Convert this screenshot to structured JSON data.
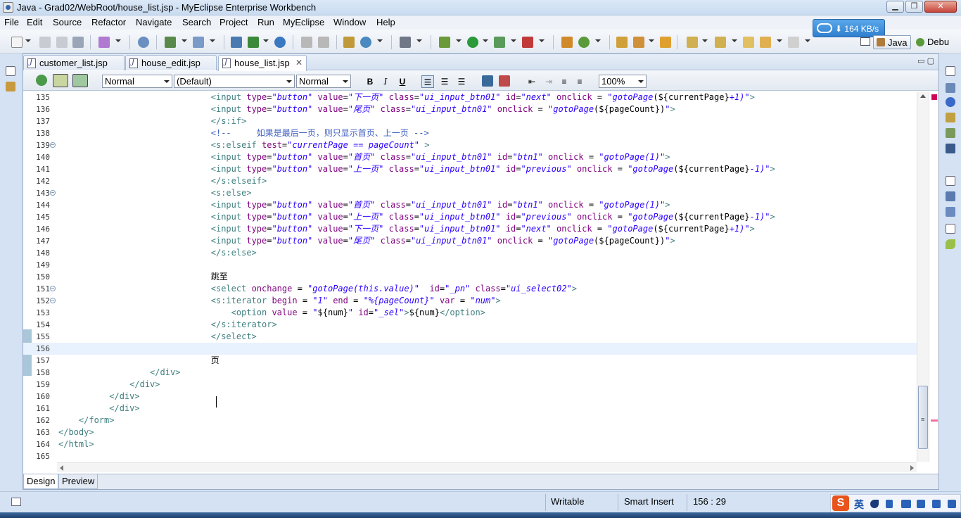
{
  "window": {
    "title": "Java - Grad02/WebRoot/house_list.jsp - MyEclipse Enterprise Workbench"
  },
  "menu": [
    "File",
    "Edit",
    "Source",
    "Refactor",
    "Navigate",
    "Search",
    "Project",
    "Run",
    "MyEclipse",
    "Window",
    "Help"
  ],
  "network_speed": "164 KB/s",
  "perspectives": {
    "java": "Java",
    "debug": "Debu"
  },
  "tabs": [
    {
      "label": "customer_list.jsp",
      "active": false
    },
    {
      "label": "house_edit.jsp",
      "active": false
    },
    {
      "label": "house_list.jsp",
      "active": true
    }
  ],
  "format_toolbar": {
    "paragraph_style": "Normal",
    "font": "(Default)",
    "size": "Normal",
    "zoom": "100%",
    "bold": "B",
    "italic": "I",
    "underline": "U"
  },
  "code_lines": [
    {
      "n": "135",
      "fold": "",
      "html": "                              <span class=\"t-tag\">&lt;input</span> <span class=\"t-attr\">type</span>=<span class=\"t-val\">\"button\"</span> <span class=\"t-attr\">value</span>=<span class=\"t-val\">\"下一页\"</span> <span class=\"t-attr\">class</span>=<span class=\"t-val\">\"ui_input_btn01\"</span> <span class=\"t-attr\">id</span>=<span class=\"t-val\">\"next\"</span> <span class=\"t-attr\">onclick</span> = <span class=\"t-val\">\"gotoPage</span>(${currentPage}<span class=\"t-val\">+1)\"</span><span class=\"t-tag\">&gt;</span>"
    },
    {
      "n": "136",
      "fold": "",
      "html": "                              <span class=\"t-tag\">&lt;input</span> <span class=\"t-attr\">type</span>=<span class=\"t-val\">\"button\"</span> <span class=\"t-attr\">value</span>=<span class=\"t-val\">\"尾页\"</span> <span class=\"t-attr\">class</span>=<span class=\"t-val\">\"ui_input_btn01\"</span> <span class=\"t-attr\">onclick</span> = <span class=\"t-val\">\"gotoPage</span>(${pageCount})<span class=\"t-val\">\"</span><span class=\"t-tag\">&gt;</span>"
    },
    {
      "n": "137",
      "fold": "",
      "html": "                              <span class=\"t-tag\">&lt;/s:if&gt;</span>"
    },
    {
      "n": "138",
      "fold": "",
      "html": "                              <span class=\"t-cmt\">&lt;!--     如果是最后一页，则只显示首页、上一页 --&gt;</span>"
    },
    {
      "n": "139",
      "fold": "⊖",
      "html": "                              <span class=\"t-tag\">&lt;s:elseif</span> <span class=\"t-attr\">test</span>=<span class=\"t-val\">\"currentPage == pageCount\"</span> <span class=\"t-tag\">&gt;</span>"
    },
    {
      "n": "140",
      "fold": "",
      "html": "                              <span class=\"t-tag\">&lt;input</span> <span class=\"t-attr\">type</span>=<span class=\"t-val\">\"button\"</span> <span class=\"t-attr\">value</span>=<span class=\"t-val\">\"首页\"</span> <span class=\"t-attr\">class</span>=<span class=\"t-val\">\"ui_input_btn01\"</span> <span class=\"t-attr\">id</span>=<span class=\"t-val\">\"btn1\"</span> <span class=\"t-attr\">onclick</span> = <span class=\"t-val\">\"gotoPage(1)\"</span><span class=\"t-tag\">&gt;</span>"
    },
    {
      "n": "141",
      "fold": "",
      "html": "                              <span class=\"t-tag\">&lt;input</span> <span class=\"t-attr\">type</span>=<span class=\"t-val\">\"button\"</span> <span class=\"t-attr\">value</span>=<span class=\"t-val\">\"上一页\"</span> <span class=\"t-attr\">class</span>=<span class=\"t-val\">\"ui_input_btn01\"</span> <span class=\"t-attr\">id</span>=<span class=\"t-val\">\"previous\"</span> <span class=\"t-attr\">onclick</span> = <span class=\"t-val\">\"gotoPage</span>(${currentPage}<span class=\"t-val\">-1)\"</span><span class=\"t-tag\">&gt;</span>"
    },
    {
      "n": "142",
      "fold": "",
      "html": "                              <span class=\"t-tag\">&lt;/s:elseif&gt;</span>"
    },
    {
      "n": "143",
      "fold": "⊖",
      "html": "                              <span class=\"t-tag\">&lt;s:else&gt;</span>"
    },
    {
      "n": "144",
      "fold": "",
      "html": "                              <span class=\"t-tag\">&lt;input</span> <span class=\"t-attr\">type</span>=<span class=\"t-val\">\"button\"</span> <span class=\"t-attr\">value</span>=<span class=\"t-val\">\"首页\"</span> <span class=\"t-attr\">class</span>=<span class=\"t-val\">\"ui_input_btn01\"</span> <span class=\"t-attr\">id</span>=<span class=\"t-val\">\"btn1\"</span> <span class=\"t-attr\">onclick</span> = <span class=\"t-val\">\"gotoPage(1)\"</span><span class=\"t-tag\">&gt;</span>"
    },
    {
      "n": "145",
      "fold": "",
      "html": "                              <span class=\"t-tag\">&lt;input</span> <span class=\"t-attr\">type</span>=<span class=\"t-val\">\"button\"</span> <span class=\"t-attr\">value</span>=<span class=\"t-val\">\"上一页\"</span> <span class=\"t-attr\">class</span>=<span class=\"t-val\">\"ui_input_btn01\"</span> <span class=\"t-attr\">id</span>=<span class=\"t-val\">\"previous\"</span> <span class=\"t-attr\">onclick</span> = <span class=\"t-val\">\"gotoPage</span>(${currentPage}<span class=\"t-val\">-1)\"</span><span class=\"t-tag\">&gt;</span>"
    },
    {
      "n": "146",
      "fold": "",
      "html": "                              <span class=\"t-tag\">&lt;input</span> <span class=\"t-attr\">type</span>=<span class=\"t-val\">\"button\"</span> <span class=\"t-attr\">value</span>=<span class=\"t-val\">\"下一页\"</span> <span class=\"t-attr\">class</span>=<span class=\"t-val\">\"ui_input_btn01\"</span> <span class=\"t-attr\">id</span>=<span class=\"t-val\">\"next\"</span> <span class=\"t-attr\">onclick</span> = <span class=\"t-val\">\"gotoPage</span>(${currentPage}<span class=\"t-val\">+1)\"</span><span class=\"t-tag\">&gt;</span>"
    },
    {
      "n": "147",
      "fold": "",
      "html": "                              <span class=\"t-tag\">&lt;input</span> <span class=\"t-attr\">type</span>=<span class=\"t-val\">\"button\"</span> <span class=\"t-attr\">value</span>=<span class=\"t-val\">\"尾页\"</span> <span class=\"t-attr\">class</span>=<span class=\"t-val\">\"ui_input_btn01\"</span> <span class=\"t-attr\">onclick</span> = <span class=\"t-val\">\"gotoPage</span>(${pageCount})<span class=\"t-val\">\"</span><span class=\"t-tag\">&gt;</span>"
    },
    {
      "n": "148",
      "fold": "",
      "html": "                              <span class=\"t-tag\">&lt;/s:else&gt;</span>"
    },
    {
      "n": "149",
      "fold": "",
      "html": ""
    },
    {
      "n": "150",
      "fold": "",
      "html": "                              <span class=\"t-txt\">跳至</span>"
    },
    {
      "n": "151",
      "fold": "⊖",
      "html": "                              <span class=\"t-tag\">&lt;select</span> <span class=\"t-attr\">onchange</span> = <span class=\"t-val\">\"gotoPage(this.value)\"</span>  <span class=\"t-attr\">id</span>=<span class=\"t-val\">\"_pn\"</span> <span class=\"t-attr\">class</span>=<span class=\"t-val\">\"ui_select02\"</span><span class=\"t-tag\">&gt;</span>"
    },
    {
      "n": "152",
      "fold": "⊖",
      "html": "                              <span class=\"t-tag\">&lt;s:iterator</span> <span class=\"t-attr\">begin</span> = <span class=\"t-val\">\"1\"</span> <span class=\"t-attr\">end</span> = <span class=\"t-val\">\"%{pageCount}\"</span> <span class=\"t-attr\">var</span> = <span class=\"t-val\">\"num\"</span><span class=\"t-tag\">&gt;</span>"
    },
    {
      "n": "153",
      "fold": "",
      "html": "                                  <span class=\"t-tag\">&lt;option</span> <span class=\"t-attr\">value</span> = <span class=\"t-val\">\"</span>${num}<span class=\"t-val\">\"</span> <span class=\"t-attr\">id</span>=<span class=\"t-val\">\"_sel\"</span><span class=\"t-tag\">&gt;</span>${num}<span class=\"t-tag\">&lt;/option&gt;</span>"
    },
    {
      "n": "154",
      "fold": "",
      "html": "                              <span class=\"t-tag\">&lt;/s:iterator&gt;</span>"
    },
    {
      "n": "155",
      "fold": "",
      "html": "                              <span class=\"t-tag\">&lt;/select&gt;</span>"
    },
    {
      "n": "156",
      "fold": "",
      "html": ""
    },
    {
      "n": "157",
      "fold": "",
      "html": "                              <span class=\"t-txt\">页</span>"
    },
    {
      "n": "158",
      "fold": "",
      "html": "                  <span class=\"t-tag\">&lt;/div&gt;</span>"
    },
    {
      "n": "159",
      "fold": "",
      "html": "              <span class=\"t-tag\">&lt;/div&gt;</span>"
    },
    {
      "n": "160",
      "fold": "",
      "html": "          <span class=\"t-tag\">&lt;/div&gt;</span>"
    },
    {
      "n": "161",
      "fold": "",
      "html": "          <span class=\"t-tag\">&lt;/div&gt;</span>"
    },
    {
      "n": "162",
      "fold": "",
      "html": "    <span class=\"t-tag\">&lt;/form&gt;</span>"
    },
    {
      "n": "163",
      "fold": "",
      "html": "<span class=\"t-tag\">&lt;/body&gt;</span>"
    },
    {
      "n": "164",
      "fold": "",
      "html": "<span class=\"t-tag\">&lt;/html&gt;</span>"
    },
    {
      "n": "165",
      "fold": "",
      "html": ""
    }
  ],
  "current_line": "156",
  "view_tabs": {
    "design": "Design",
    "preview": "Preview"
  },
  "status": {
    "writable": "Writable",
    "insert_mode": "Smart Insert",
    "position": "156 : 29"
  },
  "ime": {
    "logo": "S",
    "lang": "英"
  },
  "colors": {
    "accent": "#2f7fcf",
    "tag": "#3f7f7f",
    "attr": "#7f007f",
    "value": "#2a00ff",
    "comment": "#3f5fbf"
  }
}
